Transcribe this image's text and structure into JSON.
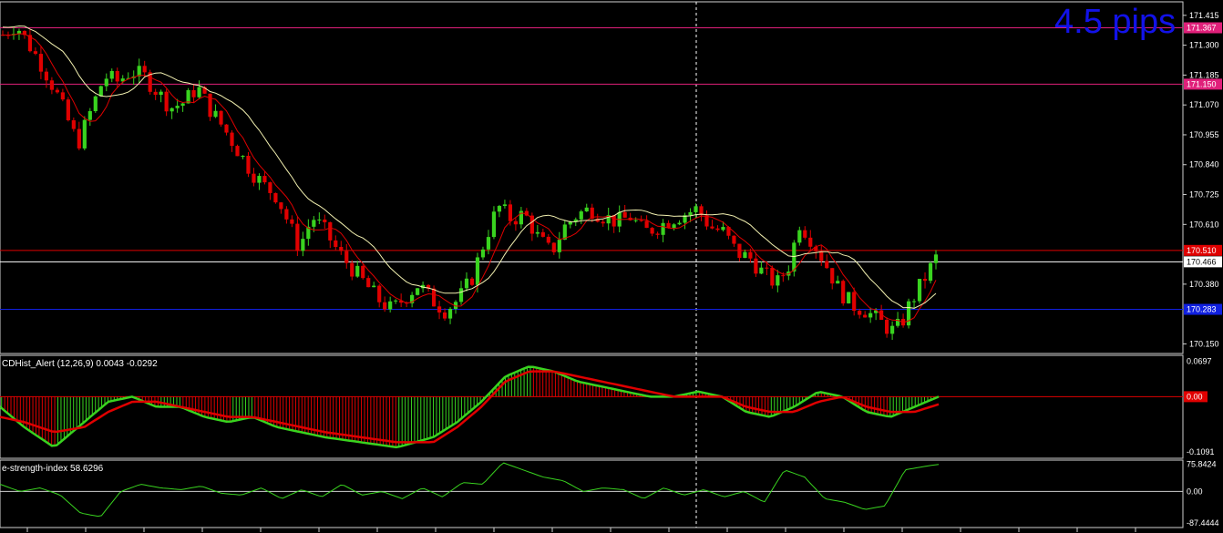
{
  "chart_data": [
    {
      "type": "candlestick",
      "name": "price",
      "pips_label": "4.5 pips",
      "ylim": [
        170.12,
        171.46
      ],
      "y_ticks": [
        "171.415",
        "171.300",
        "171.185",
        "171.070",
        "170.955",
        "170.840",
        "170.725",
        "170.610",
        "170.380",
        "170.150"
      ],
      "price_axis_tags": [
        {
          "text": "171.367",
          "value": 171.367,
          "bg": "#e0207a",
          "fg": "#ffffff"
        },
        {
          "text": "171.150",
          "value": 171.15,
          "bg": "#e0207a",
          "fg": "#ffffff"
        },
        {
          "text": "170.510",
          "value": 170.51,
          "bg": "#e00000",
          "fg": "#ffffff"
        },
        {
          "text": "170.466",
          "value": 170.466,
          "bg": "#ffffff",
          "fg": "#000000"
        },
        {
          "text": "170.283",
          "value": 170.283,
          "bg": "#1020e0",
          "fg": "#ffffff"
        }
      ],
      "horizontal_lines": [
        {
          "value": 171.367,
          "color": "#e0207a"
        },
        {
          "value": 171.15,
          "color": "#e0207a"
        },
        {
          "value": 170.51,
          "color": "#e00000"
        },
        {
          "value": 170.466,
          "color": "#ffffff"
        },
        {
          "value": 170.283,
          "color": "#1020e0"
        }
      ],
      "close_path": [
        [
          0,
          171.34
        ],
        [
          6,
          171.38
        ],
        [
          12,
          171.3
        ],
        [
          18,
          171.22
        ],
        [
          24,
          171.12
        ],
        [
          30,
          171.0
        ],
        [
          34,
          170.92
        ],
        [
          40,
          171.05
        ],
        [
          46,
          171.18
        ],
        [
          52,
          171.16
        ],
        [
          58,
          171.2
        ],
        [
          64,
          171.18
        ],
        [
          70,
          171.12
        ],
        [
          76,
          171.06
        ],
        [
          82,
          171.08
        ],
        [
          88,
          171.14
        ],
        [
          94,
          171.05
        ],
        [
          100,
          170.98
        ],
        [
          106,
          170.9
        ],
        [
          112,
          170.82
        ],
        [
          118,
          170.76
        ],
        [
          124,
          170.72
        ],
        [
          130,
          170.6
        ],
        [
          134,
          170.52
        ],
        [
          140,
          170.64
        ],
        [
          146,
          170.58
        ],
        [
          152,
          170.5
        ],
        [
          158,
          170.44
        ],
        [
          164,
          170.38
        ],
        [
          170,
          170.32
        ],
        [
          176,
          170.28
        ],
        [
          182,
          170.33
        ],
        [
          188,
          170.38
        ],
        [
          194,
          170.32
        ],
        [
          200,
          170.28
        ],
        [
          206,
          170.32
        ],
        [
          212,
          170.4
        ],
        [
          218,
          170.55
        ],
        [
          224,
          170.68
        ],
        [
          230,
          170.63
        ],
        [
          236,
          170.65
        ],
        [
          242,
          170.56
        ],
        [
          248,
          170.5
        ],
        [
          254,
          170.6
        ],
        [
          260,
          170.65
        ],
        [
          266,
          170.67
        ],
        [
          272,
          170.64
        ],
        [
          278,
          170.62
        ],
        [
          284,
          170.64
        ],
        [
          290,
          170.58
        ],
        [
          296,
          170.6
        ],
        [
          302,
          170.63
        ],
        [
          308,
          170.65
        ],
        [
          314,
          170.67
        ],
        [
          320,
          170.6
        ],
        [
          326,
          170.58
        ],
        [
          332,
          170.5
        ],
        [
          338,
          170.48
        ],
        [
          344,
          170.42
        ],
        [
          350,
          170.38
        ],
        [
          356,
          170.46
        ],
        [
          360,
          170.62
        ],
        [
          366,
          170.55
        ],
        [
          372,
          170.46
        ],
        [
          378,
          170.36
        ],
        [
          384,
          170.3
        ],
        [
          390,
          170.28
        ],
        [
          396,
          170.24
        ],
        [
          402,
          170.2
        ],
        [
          406,
          170.22
        ],
        [
          410,
          170.3
        ],
        [
          414,
          170.36
        ],
        [
          418,
          170.42
        ],
        [
          422,
          170.48
        ]
      ],
      "x_steps": 422
    },
    {
      "type": "bar+line",
      "name": "macd",
      "label": "CDHist_Alert (12,26,9)  0.0043 -0.0292",
      "ylim": [
        -0.118,
        0.078
      ],
      "y_ticks": [
        "0.0697",
        "0.00",
        "-0.1091"
      ],
      "zero_tag": {
        "text": "0.00",
        "bg": "#e00000"
      },
      "hist_colors": {
        "up": "#39d31f",
        "down": "#e00000"
      },
      "macd_line_color": "#39d31f",
      "signal_line_color": "#e00000",
      "macd_path": [
        [
          0,
          -0.02
        ],
        [
          20,
          -0.06
        ],
        [
          45,
          -0.1
        ],
        [
          70,
          -0.05
        ],
        [
          90,
          -0.01
        ],
        [
          110,
          0.0
        ],
        [
          130,
          -0.02
        ],
        [
          150,
          -0.02
        ],
        [
          170,
          -0.04
        ],
        [
          190,
          -0.05
        ],
        [
          210,
          -0.04
        ],
        [
          230,
          -0.06
        ],
        [
          250,
          -0.07
        ],
        [
          270,
          -0.08
        ],
        [
          300,
          -0.09
        ],
        [
          330,
          -0.1
        ],
        [
          360,
          -0.08
        ],
        [
          380,
          -0.05
        ],
        [
          400,
          -0.01
        ],
        [
          420,
          0.04
        ],
        [
          440,
          0.06
        ],
        [
          460,
          0.05
        ],
        [
          480,
          0.03
        ],
        [
          500,
          0.02
        ],
        [
          520,
          0.01
        ],
        [
          540,
          0.0
        ],
        [
          560,
          0.0
        ],
        [
          580,
          0.01
        ],
        [
          600,
          0.0
        ],
        [
          620,
          -0.03
        ],
        [
          640,
          -0.04
        ],
        [
          660,
          -0.02
        ],
        [
          680,
          0.01
        ],
        [
          700,
          0.0
        ],
        [
          720,
          -0.03
        ],
        [
          740,
          -0.04
        ],
        [
          760,
          -0.02
        ],
        [
          780,
          0.0
        ]
      ],
      "signal_path": [
        [
          0,
          -0.04
        ],
        [
          20,
          -0.05
        ],
        [
          45,
          -0.07
        ],
        [
          70,
          -0.06
        ],
        [
          90,
          -0.03
        ],
        [
          110,
          -0.01
        ],
        [
          130,
          -0.01
        ],
        [
          150,
          -0.02
        ],
        [
          170,
          -0.03
        ],
        [
          190,
          -0.04
        ],
        [
          210,
          -0.04
        ],
        [
          230,
          -0.05
        ],
        [
          250,
          -0.06
        ],
        [
          270,
          -0.07
        ],
        [
          300,
          -0.08
        ],
        [
          330,
          -0.09
        ],
        [
          360,
          -0.09
        ],
        [
          380,
          -0.06
        ],
        [
          400,
          -0.02
        ],
        [
          420,
          0.03
        ],
        [
          440,
          0.05
        ],
        [
          460,
          0.05
        ],
        [
          480,
          0.04
        ],
        [
          500,
          0.03
        ],
        [
          520,
          0.02
        ],
        [
          540,
          0.01
        ],
        [
          560,
          0.0
        ],
        [
          580,
          0.0
        ],
        [
          600,
          0.0
        ],
        [
          620,
          -0.02
        ],
        [
          640,
          -0.03
        ],
        [
          660,
          -0.03
        ],
        [
          680,
          -0.01
        ],
        [
          700,
          0.0
        ],
        [
          720,
          -0.02
        ],
        [
          740,
          -0.03
        ],
        [
          760,
          -0.03
        ],
        [
          780,
          -0.015
        ]
      ],
      "x_steps": 780
    },
    {
      "type": "line",
      "name": "rsi",
      "label": "e-strength-index 58.6296",
      "ylim": [
        -95,
        82
      ],
      "y_ticks": [
        "75.8424",
        "0.00",
        "-87.4444"
      ],
      "line_color": "#39d31f",
      "rsi_path": [
        [
          0,
          20
        ],
        [
          15,
          0
        ],
        [
          30,
          10
        ],
        [
          45,
          -10
        ],
        [
          60,
          -60
        ],
        [
          75,
          -70
        ],
        [
          90,
          0
        ],
        [
          105,
          20
        ],
        [
          120,
          10
        ],
        [
          135,
          5
        ],
        [
          150,
          15
        ],
        [
          165,
          -5
        ],
        [
          180,
          -10
        ],
        [
          195,
          10
        ],
        [
          210,
          -20
        ],
        [
          225,
          5
        ],
        [
          240,
          -15
        ],
        [
          255,
          20
        ],
        [
          270,
          -10
        ],
        [
          285,
          0
        ],
        [
          300,
          -20
        ],
        [
          315,
          10
        ],
        [
          330,
          -15
        ],
        [
          345,
          25
        ],
        [
          360,
          20
        ],
        [
          375,
          80
        ],
        [
          390,
          60
        ],
        [
          405,
          40
        ],
        [
          420,
          30
        ],
        [
          435,
          0
        ],
        [
          450,
          10
        ],
        [
          465,
          5
        ],
        [
          480,
          -20
        ],
        [
          495,
          10
        ],
        [
          510,
          -10
        ],
        [
          525,
          5
        ],
        [
          540,
          -15
        ],
        [
          555,
          0
        ],
        [
          570,
          -30
        ],
        [
          585,
          60
        ],
        [
          600,
          40
        ],
        [
          615,
          -20
        ],
        [
          630,
          -30
        ],
        [
          645,
          -50
        ],
        [
          660,
          -40
        ],
        [
          675,
          60
        ],
        [
          690,
          70
        ],
        [
          700,
          75
        ]
      ],
      "x_steps": 700
    }
  ]
}
